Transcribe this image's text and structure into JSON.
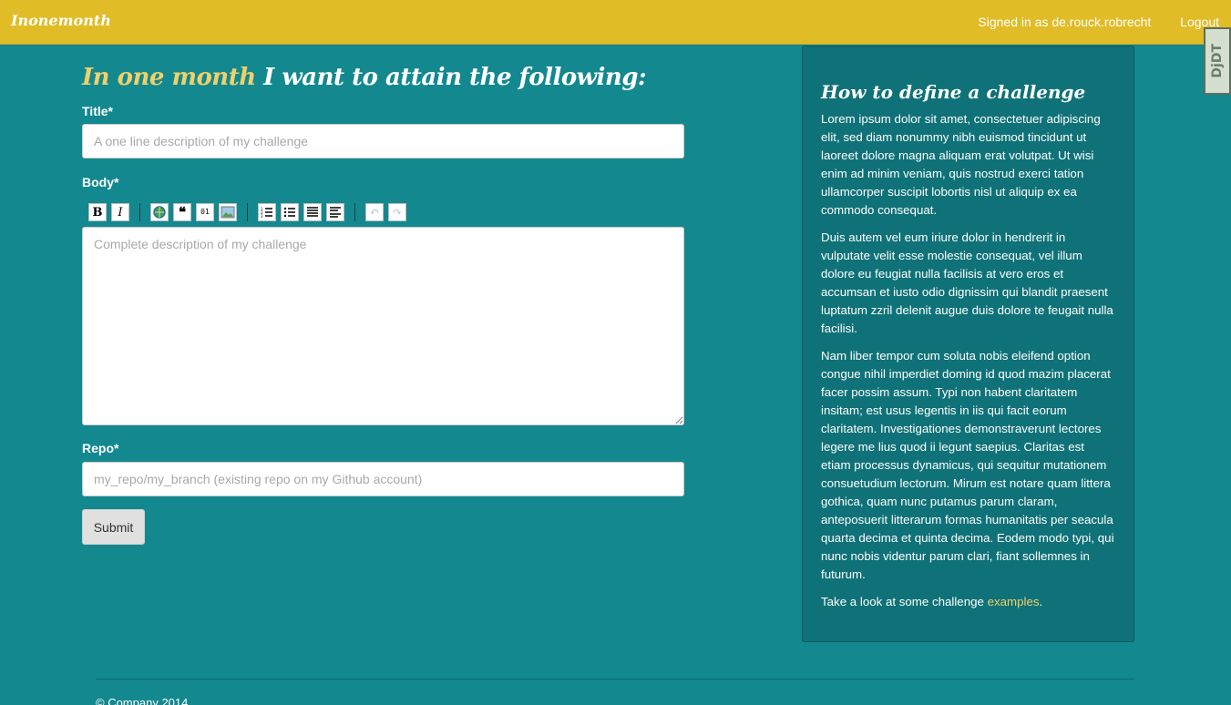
{
  "navbar": {
    "brand": "Inonemonth",
    "signed_in": "Signed in as de.rouck.robrecht",
    "logout": "Logout"
  },
  "main": {
    "title_highlight": "In one month",
    "title_rest": " I want to attain the following:",
    "title_label": "Title*",
    "title_placeholder": "A one line description of my challenge",
    "body_label": "Body*",
    "body_placeholder": "Complete description of my challenge",
    "repo_label": "Repo*",
    "repo_placeholder": "my_repo/my_branch (existing repo on my Github account)",
    "submit": "Submit"
  },
  "toolbar": {
    "bold": "B",
    "italic": "I",
    "quote": "❝",
    "code": "01",
    "undo": "↶",
    "redo": "↷"
  },
  "sidebar": {
    "title": "How to define a challenge",
    "p1": "Lorem ipsum dolor sit amet, consectetuer adipiscing elit, sed diam nonummy nibh euismod tincidunt ut laoreet dolore magna aliquam erat volutpat. Ut wisi enim ad minim veniam, quis nostrud exerci tation ullamcorper suscipit lobortis nisl ut aliquip ex ea commodo consequat.",
    "p2": "Duis autem vel eum iriure dolor in hendrerit in vulputate velit esse molestie consequat, vel illum dolore eu feugiat nulla facilisis at vero eros et accumsan et iusto odio dignissim qui blandit praesent luptatum zzril delenit augue duis dolore te feugait nulla facilisi.",
    "p3": "Nam liber tempor cum soluta nobis eleifend option congue nihil imperdiet doming id quod mazim placerat facer possim assum. Typi non habent claritatem insitam; est usus legentis in iis qui facit eorum claritatem. Investigationes demonstraverunt lectores legere me lius quod ii legunt saepius. Claritas est etiam processus dynamicus, qui sequitur mutationem consuetudium lectorum. Mirum est notare quam littera gothica, quam nunc putamus parum claram, anteposuerit litterarum formas humanitatis per seacula quarta decima et quinta decima. Eodem modo typi, qui nunc nobis videntur parum clari, fiant sollemnes in futurum.",
    "p4_prefix": "Take a look at some challenge ",
    "p4_link": "examples",
    "p4_suffix": "."
  },
  "ddt_badge": "DjDT",
  "footer": {
    "text": "© Company 2014"
  }
}
